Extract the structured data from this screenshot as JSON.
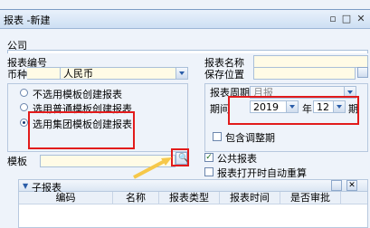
{
  "window": {
    "title": "报表 -新建"
  },
  "form": {
    "company_label": "公司",
    "report_code_label": "报表编号",
    "report_name_label": "报表名称",
    "currency_label": "币种",
    "currency_value": "人民币",
    "save_location_label": "保存位置",
    "template_label": "模板"
  },
  "template_options": {
    "no_template": "不选用模板创建报表",
    "normal_template": "选用普通模板创建报表",
    "group_template": "选用集团模板创建报表"
  },
  "period": {
    "cycle_label": "报表周期",
    "cycle_value": "月报",
    "period_label": "期间",
    "year_value": "2019",
    "year_label": "年",
    "month_value": "12",
    "month_label": "期",
    "include_adjust_label": "包含调整期"
  },
  "options": {
    "public_report_label": "公共报表",
    "auto_recalc_label": "报表打开时自动重算"
  },
  "subreport": {
    "title": "子报表",
    "columns": [
      "编码",
      "名称",
      "报表类型",
      "报表时间",
      "是否审批"
    ]
  }
}
